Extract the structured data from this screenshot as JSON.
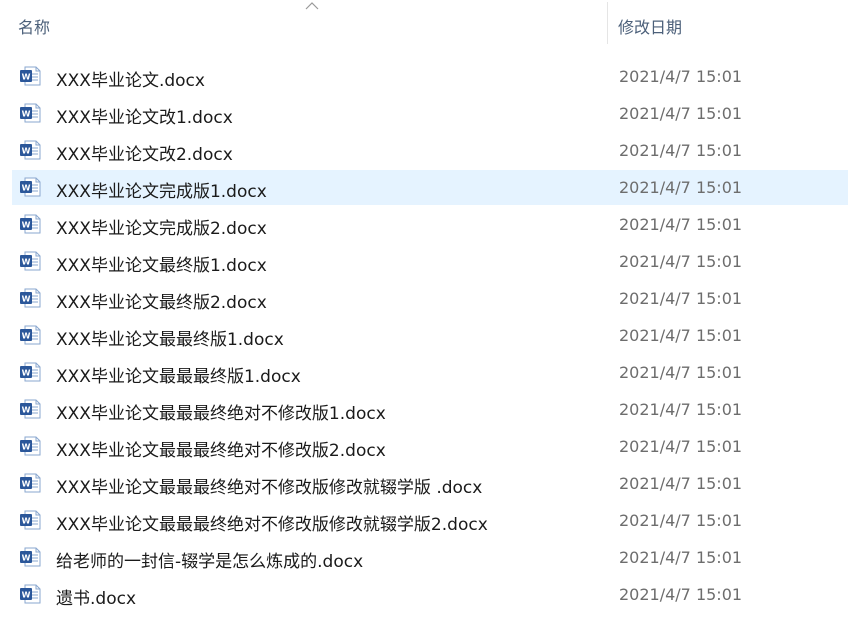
{
  "header": {
    "name_label": "名称",
    "date_label": "修改日期",
    "sort_icon": "chevron-up-icon"
  },
  "file_icon": "word-document-icon",
  "colors": {
    "selection": "#e5f3ff",
    "word_blue": "#2b579a",
    "date_text": "#6d6d6d"
  },
  "files": [
    {
      "name": "XXX毕业论文.docx",
      "modified": "2021/4/7 15:01"
    },
    {
      "name": "XXX毕业论文改1.docx",
      "modified": "2021/4/7 15:01"
    },
    {
      "name": "XXX毕业论文改2.docx",
      "modified": "2021/4/7 15:01"
    },
    {
      "name": "XXX毕业论文完成版1.docx",
      "modified": "2021/4/7 15:01",
      "selected": true
    },
    {
      "name": "XXX毕业论文完成版2.docx",
      "modified": "2021/4/7 15:01"
    },
    {
      "name": "XXX毕业论文最终版1.docx",
      "modified": "2021/4/7 15:01"
    },
    {
      "name": "XXX毕业论文最终版2.docx",
      "modified": "2021/4/7 15:01"
    },
    {
      "name": "XXX毕业论文最最终版1.docx",
      "modified": "2021/4/7 15:01"
    },
    {
      "name": "XXX毕业论文最最最终版1.docx",
      "modified": "2021/4/7 15:01"
    },
    {
      "name": "XXX毕业论文最最最终绝对不修改版1.docx",
      "modified": "2021/4/7 15:01"
    },
    {
      "name": "XXX毕业论文最最最终绝对不修改版2.docx",
      "modified": "2021/4/7 15:01"
    },
    {
      "name": "XXX毕业论文最最最终绝对不修改版修改就辍学版 .docx",
      "modified": "2021/4/7 15:01"
    },
    {
      "name": "XXX毕业论文最最最终绝对不修改版修改就辍学版2.docx",
      "modified": "2021/4/7 15:01"
    },
    {
      "name": "给老师的一封信-辍学是怎么炼成的.docx",
      "modified": "2021/4/7 15:01"
    },
    {
      "name": "遗书.docx",
      "modified": "2021/4/7 15:01"
    }
  ]
}
